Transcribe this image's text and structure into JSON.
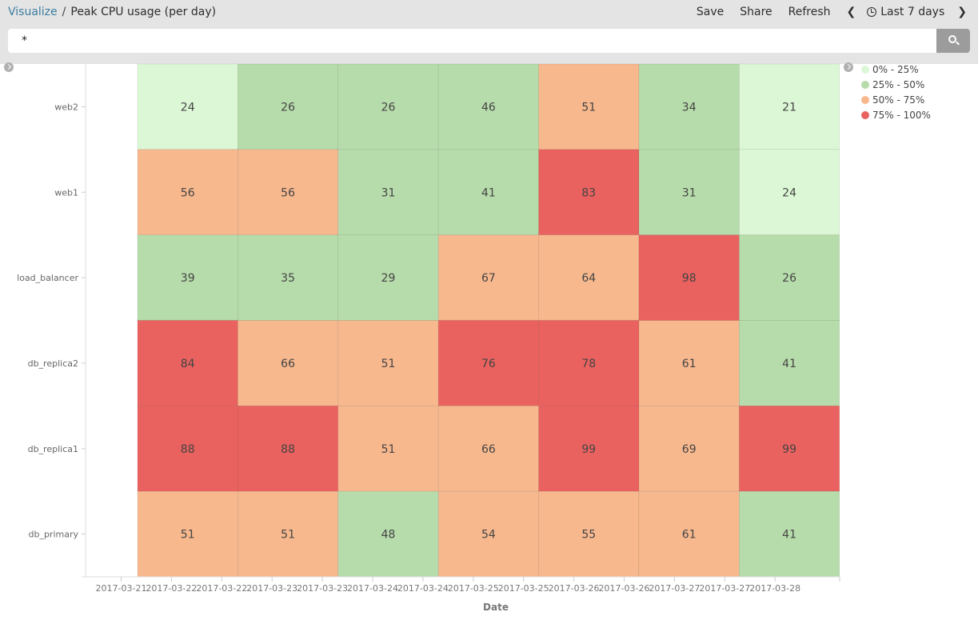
{
  "header": {
    "breadcrumb_link": "Visualize",
    "breadcrumb_separator": "/",
    "title": "Peak CPU usage (per day)",
    "menu": {
      "save": "Save",
      "share": "Share",
      "refresh": "Refresh",
      "time_range": "Last 7 days"
    }
  },
  "search": {
    "query": "*",
    "button_icon": "search-icon"
  },
  "icons": {
    "prev": "chevron-left-icon",
    "next": "chevron-right-icon",
    "clock": "clock-icon",
    "legend_toggle": "chevron-right-circle-icon",
    "sidebar_toggle": "chevron-right-circle-icon"
  },
  "legend": [
    {
      "label": "0% - 25%",
      "color": "#dcf7d6"
    },
    {
      "label": "25% - 50%",
      "color": "#b7dcab"
    },
    {
      "label": "50% - 75%",
      "color": "#f7b88e"
    },
    {
      "label": "75% - 100%",
      "color": "#e9625f"
    }
  ],
  "chart_data": {
    "type": "heatmap",
    "title": "Peak CPU usage (per day)",
    "xlabel": "Date",
    "ylabel": "",
    "x_categories": [
      "2017-03-22",
      "2017-03-23",
      "2017-03-24",
      "2017-03-25",
      "2017-03-26",
      "2017-03-27",
      "2017-03-28"
    ],
    "x_tick_labels": [
      "2017-03-21",
      "2017-03-22",
      "2017-03-22",
      "2017-03-23",
      "2017-03-23",
      "2017-03-24",
      "2017-03-24",
      "2017-03-25",
      "2017-03-25",
      "2017-03-26",
      "2017-03-26",
      "2017-03-27",
      "2017-03-27",
      "2017-03-28"
    ],
    "y_categories": [
      "web2",
      "web1",
      "load_balancer",
      "db_replica2",
      "db_replica1",
      "db_primary"
    ],
    "values": [
      [
        24,
        26,
        26,
        46,
        51,
        34,
        21
      ],
      [
        56,
        56,
        31,
        41,
        83,
        31,
        24
      ],
      [
        39,
        35,
        29,
        67,
        64,
        98,
        26
      ],
      [
        84,
        66,
        51,
        76,
        78,
        61,
        41
      ],
      [
        88,
        88,
        51,
        66,
        99,
        69,
        99
      ],
      [
        51,
        51,
        48,
        54,
        55,
        61,
        41
      ]
    ],
    "color_ranges": [
      {
        "from": 0,
        "to": 25,
        "label": "0% - 25%",
        "color": "#dcf7d6"
      },
      {
        "from": 25,
        "to": 50,
        "label": "25% - 50%",
        "color": "#b7dcab"
      },
      {
        "from": 50,
        "to": 75,
        "label": "50% - 75%",
        "color": "#f7b88e"
      },
      {
        "from": 75,
        "to": 100,
        "label": "75% - 100%",
        "color": "#e9625f"
      }
    ],
    "legend_position": "right",
    "show_values": true,
    "grid": false
  }
}
